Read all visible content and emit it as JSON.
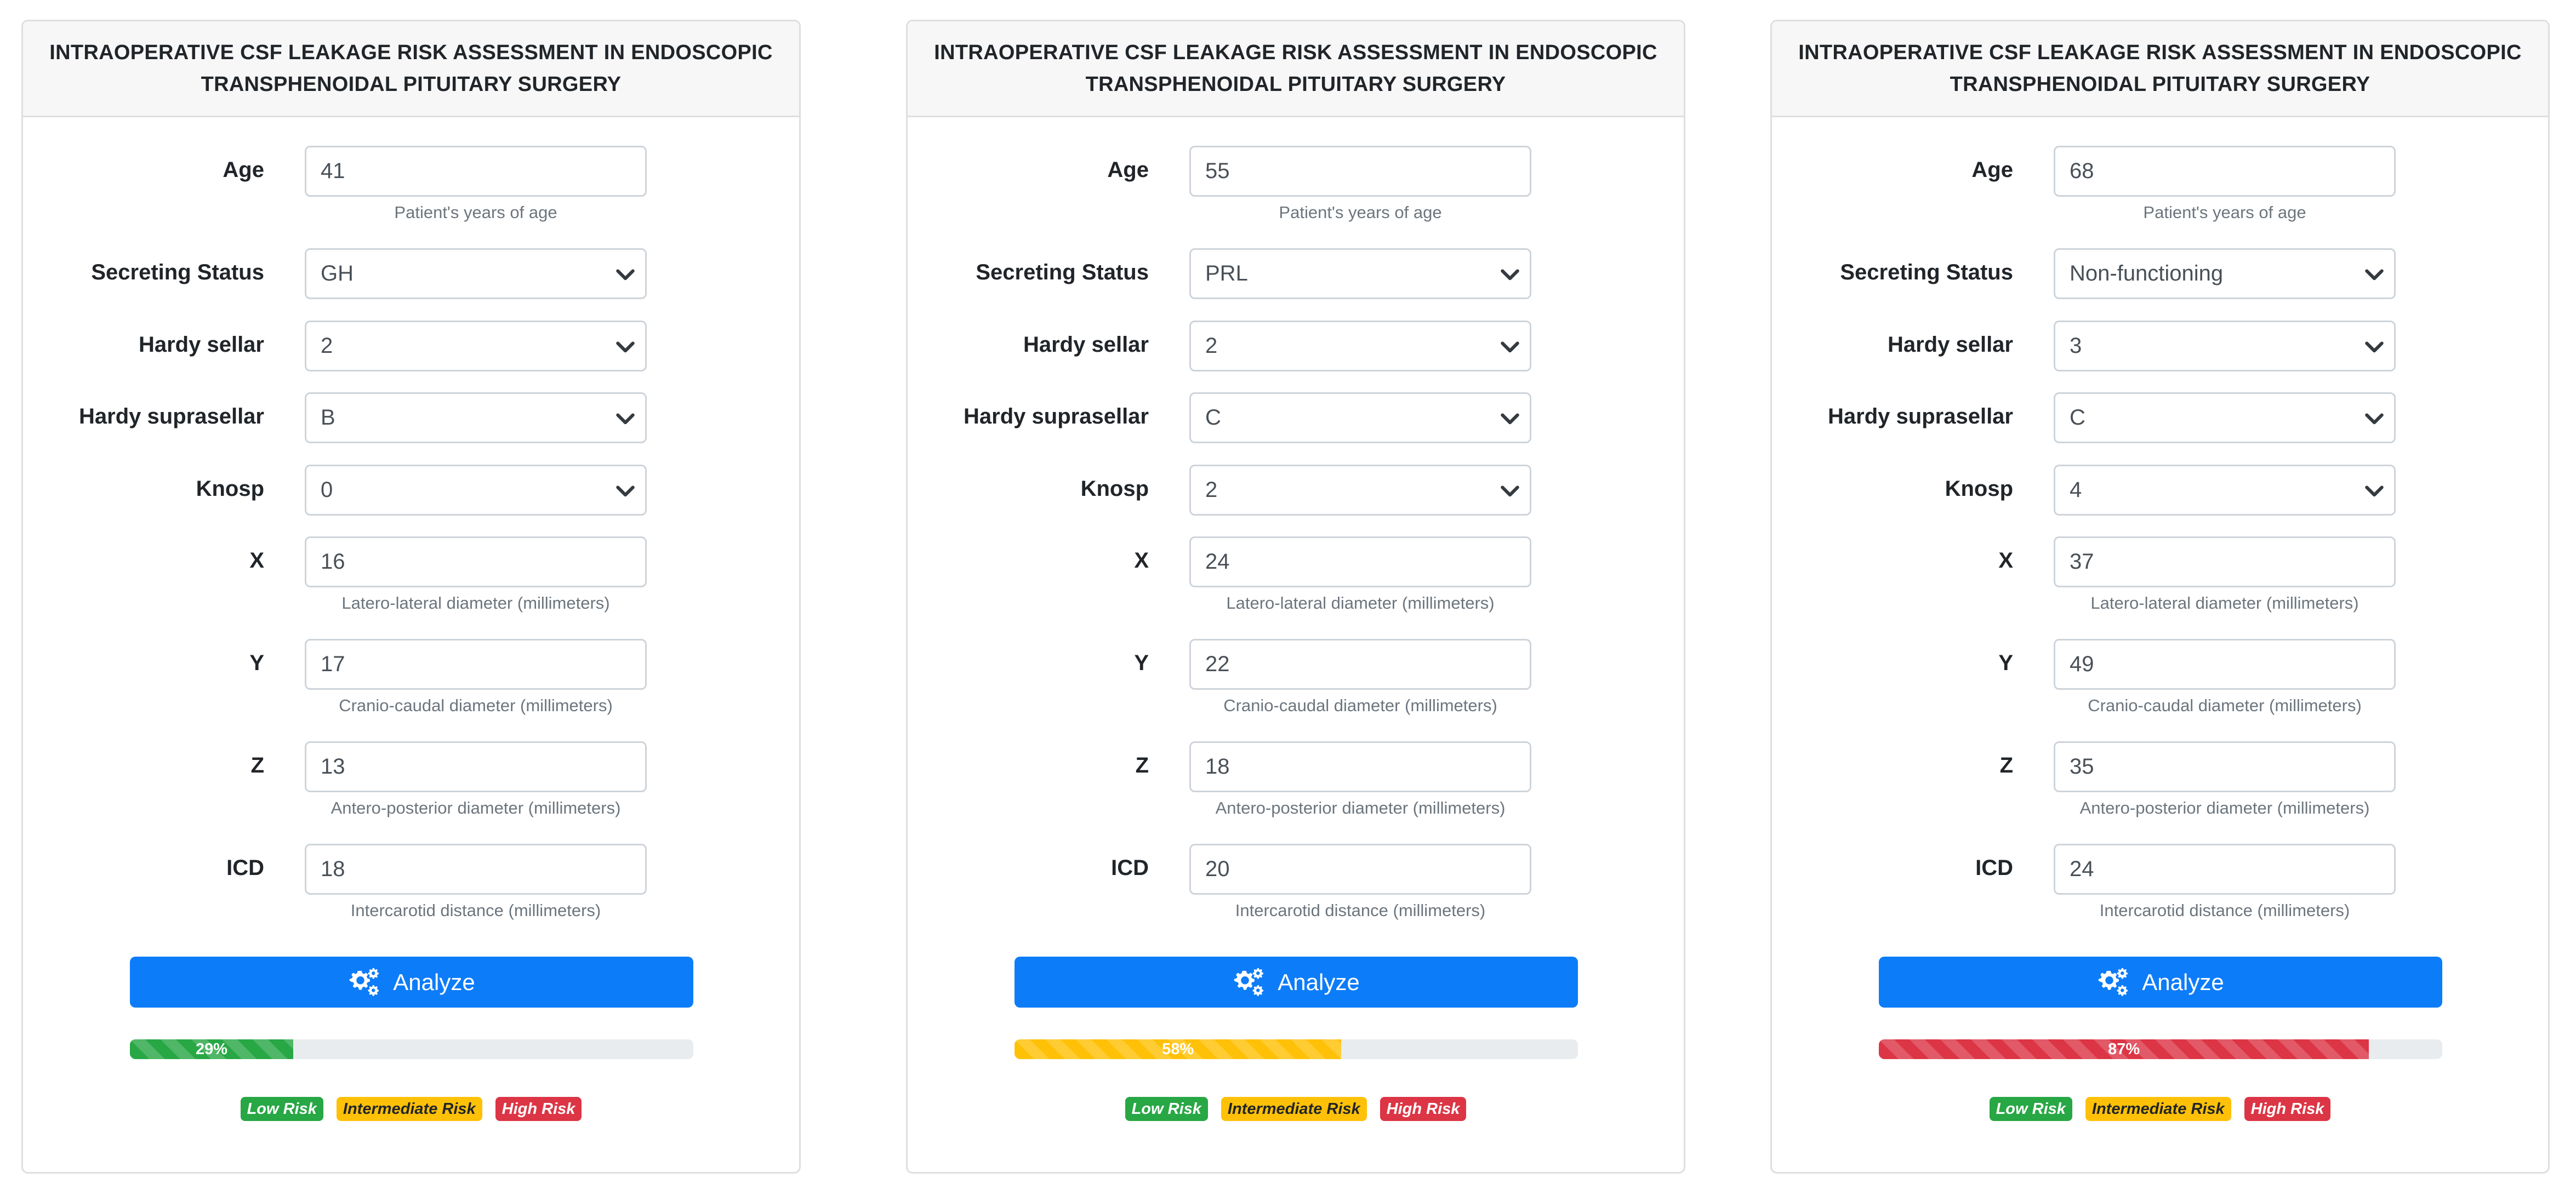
{
  "cards": [
    {
      "title": "INTRAOPERATIVE CSF LEAKAGE RISK ASSESSMENT IN ENDOSCOPIC TRANSPHENOIDAL PITUITARY SURGERY",
      "age_label": "Age",
      "age_value": "41",
      "age_help": "Patient's years of age",
      "secreting_label": "Secreting Status",
      "secreting_value": "GH",
      "hardy_sellar_label": "Hardy sellar",
      "hardy_sellar_value": "2",
      "hardy_supra_label": "Hardy suprasellar",
      "hardy_supra_value": "B",
      "knosp_label": "Knosp",
      "knosp_value": "0",
      "x_label": "X",
      "x_value": "16",
      "x_help": "Latero-lateral diameter (millimeters)",
      "y_label": "Y",
      "y_value": "17",
      "y_help": "Cranio-caudal diameter (millimeters)",
      "z_label": "Z",
      "z_value": "13",
      "z_help": "Antero-posterior diameter (millimeters)",
      "icd_label": "ICD",
      "icd_value": "18",
      "icd_help": "Intercarotid distance (millimeters)",
      "analyze_label": "Analyze",
      "risk_percent": 29,
      "risk_text": "29%",
      "risk_color": "#28a745",
      "badges": [
        "Low Risk",
        "Intermediate Risk",
        "High Risk"
      ]
    },
    {
      "title": "INTRAOPERATIVE CSF LEAKAGE RISK ASSESSMENT IN ENDOSCOPIC TRANSPHENOIDAL PITUITARY SURGERY",
      "age_label": "Age",
      "age_value": "55",
      "age_help": "Patient's years of age",
      "secreting_label": "Secreting Status",
      "secreting_value": "PRL",
      "hardy_sellar_label": "Hardy sellar",
      "hardy_sellar_value": "2",
      "hardy_supra_label": "Hardy suprasellar",
      "hardy_supra_value": "C",
      "knosp_label": "Knosp",
      "knosp_value": "2",
      "x_label": "X",
      "x_value": "24",
      "x_help": "Latero-lateral diameter (millimeters)",
      "y_label": "Y",
      "y_value": "22",
      "y_help": "Cranio-caudal diameter (millimeters)",
      "z_label": "Z",
      "z_value": "18",
      "z_help": "Antero-posterior diameter (millimeters)",
      "icd_label": "ICD",
      "icd_value": "20",
      "icd_help": "Intercarotid distance (millimeters)",
      "analyze_label": "Analyze",
      "risk_percent": 58,
      "risk_text": "58%",
      "risk_color": "#ffc107",
      "badges": [
        "Low Risk",
        "Intermediate Risk",
        "High Risk"
      ]
    },
    {
      "title": "INTRAOPERATIVE CSF LEAKAGE RISK ASSESSMENT IN ENDOSCOPIC TRANSPHENOIDAL PITUITARY SURGERY",
      "age_label": "Age",
      "age_value": "68",
      "age_help": "Patient's years of age",
      "secreting_label": "Secreting Status",
      "secreting_value": "Non-functioning",
      "hardy_sellar_label": "Hardy sellar",
      "hardy_sellar_value": "3",
      "hardy_supra_label": "Hardy suprasellar",
      "hardy_supra_value": "C",
      "knosp_label": "Knosp",
      "knosp_value": "4",
      "x_label": "X",
      "x_value": "37",
      "x_help": "Latero-lateral diameter (millimeters)",
      "y_label": "Y",
      "y_value": "49",
      "y_help": "Cranio-caudal diameter (millimeters)",
      "z_label": "Z",
      "z_value": "35",
      "z_help": "Antero-posterior diameter (millimeters)",
      "icd_label": "ICD",
      "icd_value": "24",
      "icd_help": "Intercarotid distance (millimeters)",
      "analyze_label": "Analyze",
      "risk_percent": 87,
      "risk_text": "87%",
      "risk_color": "#dc3545",
      "badges": [
        "Low Risk",
        "Intermediate Risk",
        "High Risk"
      ]
    }
  ],
  "badge_colors": [
    "#28a745",
    "#ffc107",
    "#dc3545"
  ],
  "badge_text_colors": [
    "#ffffff",
    "#212529",
    "#ffffff"
  ],
  "icons": {
    "select_arrow": "chevron-down-icon",
    "analyze": "cogs-icon"
  }
}
